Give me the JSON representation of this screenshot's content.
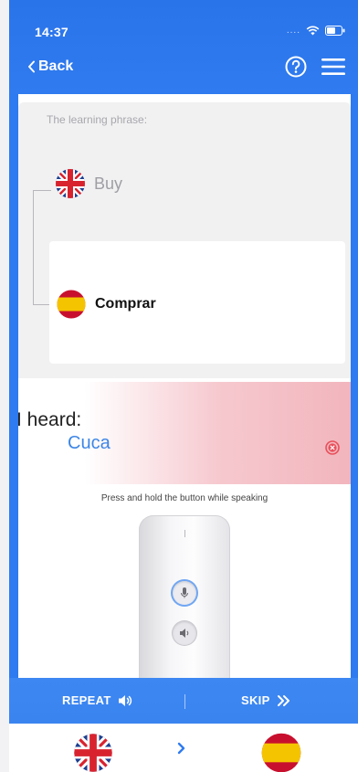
{
  "status_bar": {
    "time": "14:37",
    "dots": "...."
  },
  "header": {
    "back_label": "Back"
  },
  "phrase": {
    "label": "The learning phrase:",
    "source_text": "Buy",
    "target_text": "Comprar"
  },
  "recognition": {
    "label": "I heard:",
    "value": "Cuca"
  },
  "instruction": "Press and hold the button while speaking",
  "actions": {
    "repeat_label": "REPEAT",
    "skip_label": "SKIP"
  },
  "languages": {
    "from_icon": "uk-flag-icon",
    "to_icon": "spain-flag-icon"
  },
  "colors": {
    "accent": "#2f7bef",
    "heard_value": "#3d86e6",
    "error": "#e8505b"
  }
}
